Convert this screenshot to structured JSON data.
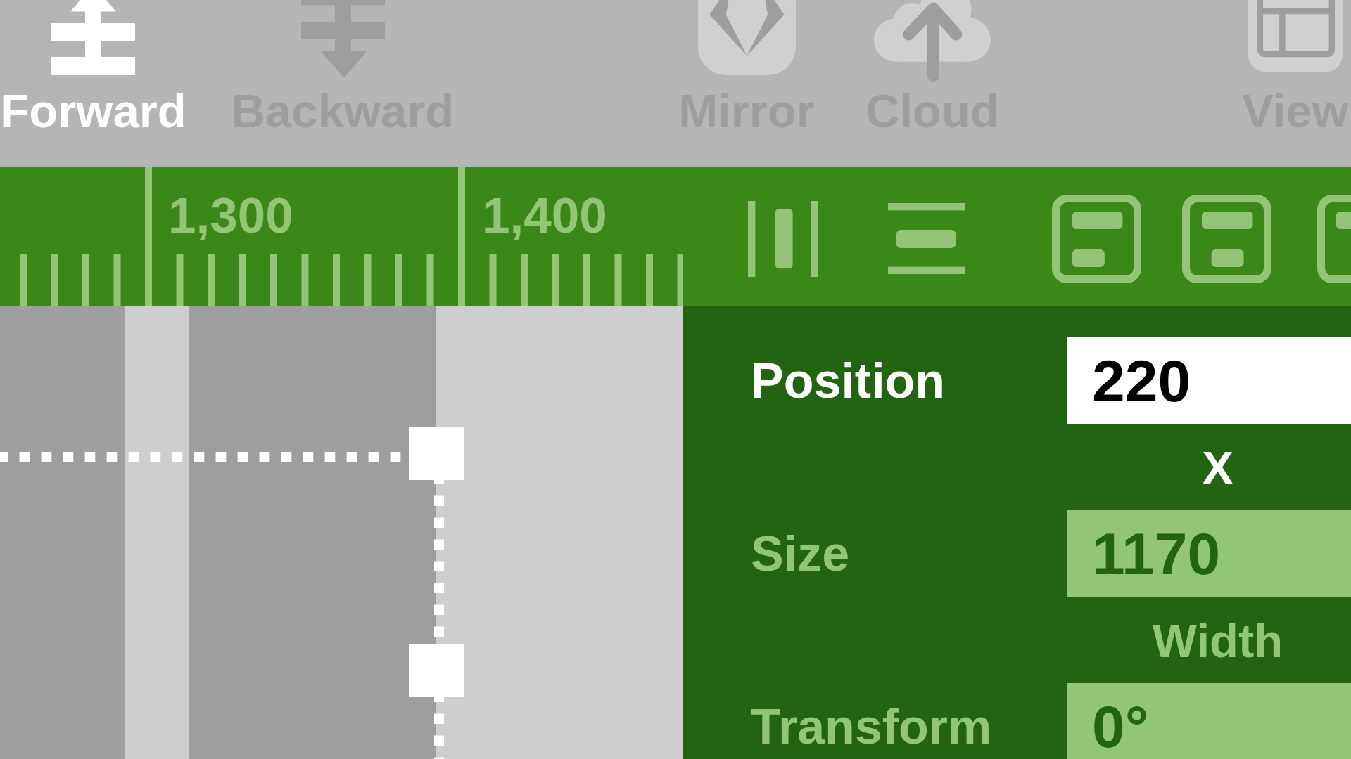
{
  "toolbar": {
    "items": [
      {
        "label": "Forward",
        "kind": "forward",
        "selected": true
      },
      {
        "label": "Backward",
        "kind": "backward",
        "selected": false
      },
      {
        "label": "Mirror",
        "kind": "mirror",
        "selected": false
      },
      {
        "label": "Cloud",
        "kind": "cloud",
        "selected": false
      },
      {
        "label": "View",
        "kind": "view",
        "selected": false
      }
    ]
  },
  "ruler": {
    "labels": [
      "1,300",
      "1,400"
    ]
  },
  "align_tools": [
    {
      "kind": "spread"
    },
    {
      "kind": "stack"
    },
    {
      "kind": "left"
    },
    {
      "kind": "center"
    },
    {
      "kind": "right"
    }
  ],
  "properties": [
    {
      "label": "Position",
      "value": "220",
      "caption": "X",
      "selected": true
    },
    {
      "label": "Size",
      "value": "1170",
      "caption": "Width",
      "selected": false
    },
    {
      "label": "Transform",
      "value": "0°",
      "selected": false
    }
  ]
}
